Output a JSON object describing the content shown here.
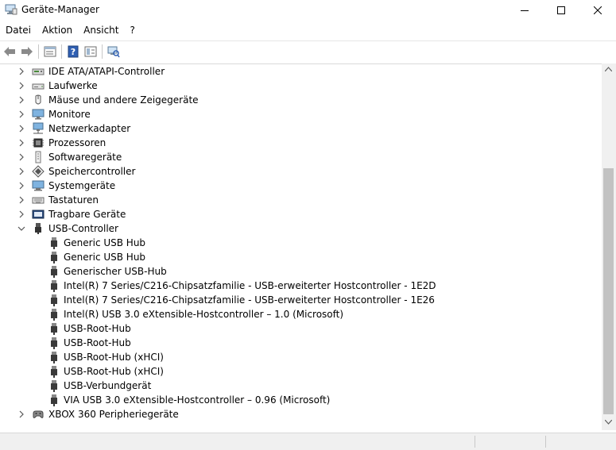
{
  "window": {
    "title": "Geräte-Manager"
  },
  "menu": [
    "Datei",
    "Aktion",
    "Ansicht",
    "?"
  ],
  "toolbar": [
    "back-arrow-icon",
    "forward-arrow-icon",
    "properties-icon",
    "help-icon",
    "view-icon",
    "scan-hardware-icon"
  ],
  "tree": {
    "categories_top": [
      {
        "label": "IDE ATA/ATAPI-Controller",
        "icon": "ide-controller-icon"
      },
      {
        "label": "Laufwerke",
        "icon": "disk-drive-icon"
      },
      {
        "label": "Mäuse und andere Zeigegeräte",
        "icon": "mouse-icon"
      },
      {
        "label": "Monitore",
        "icon": "monitor-icon"
      },
      {
        "label": "Netzwerkadapter",
        "icon": "network-adapter-icon"
      },
      {
        "label": "Prozessoren",
        "icon": "processor-icon"
      },
      {
        "label": "Softwaregeräte",
        "icon": "software-device-icon"
      },
      {
        "label": "Speichercontroller",
        "icon": "storage-controller-icon"
      },
      {
        "label": "Systemgeräte",
        "icon": "system-device-icon"
      },
      {
        "label": "Tastaturen",
        "icon": "keyboard-icon"
      },
      {
        "label": "Tragbare Geräte",
        "icon": "portable-device-icon"
      }
    ],
    "usb": {
      "label": "USB-Controller",
      "icon": "usb-icon",
      "children": [
        "Generic USB Hub",
        "Generic USB Hub",
        "Generischer USB-Hub",
        "Intel(R) 7 Series/C216-Chipsatzfamilie - USB-erweiterter Hostcontroller - 1E2D",
        "Intel(R) 7 Series/C216-Chipsatzfamilie - USB-erweiterter Hostcontroller - 1E26",
        "Intel(R) USB 3.0 eXtensible-Hostcontroller – 1.0 (Microsoft)",
        "USB-Root-Hub",
        "USB-Root-Hub",
        "USB-Root-Hub (xHCI)",
        "USB-Root-Hub (xHCI)",
        "USB-Verbundgerät",
        "VIA USB 3.0 eXtensible-Hostcontroller – 0.96 (Microsoft)"
      ]
    },
    "categories_bottom": [
      {
        "label": "XBOX 360 Peripheriegeräte",
        "icon": "gamepad-icon"
      }
    ]
  }
}
